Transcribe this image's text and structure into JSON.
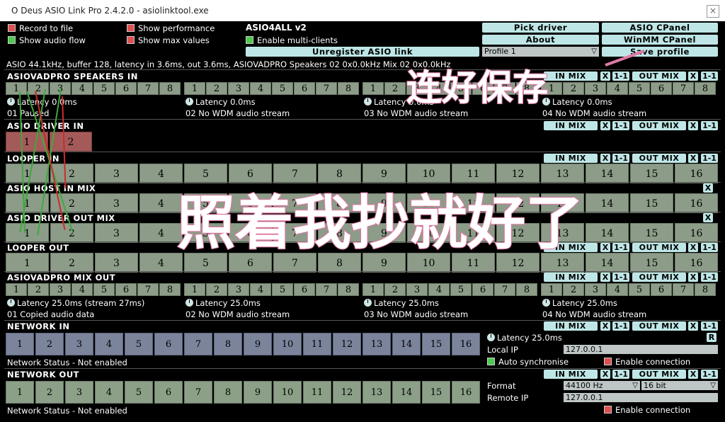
{
  "window": {
    "title": "O Deus ASIO Link Pro 2.4.2.0 - asiolinktool.exe",
    "close": "×"
  },
  "options": {
    "record_to_file": "Record to file",
    "show_audio_flow": "Show audio flow",
    "show_performance": "Show performance",
    "show_max_values": "Show max values",
    "enable_multi_clients": "Enable multi-clients"
  },
  "driver": {
    "name": "ASIO4ALL v2"
  },
  "buttons": {
    "pick_driver": "Pick driver",
    "asio_cpanel": "ASIO CPanel",
    "about": "About",
    "winmm_cpanel": "WinMM CPanel",
    "unregister": "Unregister ASIO link",
    "save_profile": "Save profile"
  },
  "profile": {
    "selected": "Profile 1"
  },
  "status_line": "ASIO 44.1kHz, buffer 128, latency in 3.6ms, out 3.6ms, ASIOVADPRO Speakers 02 0x0.0kHz Mix 02 0x0.0kHz",
  "controls": {
    "in_mix": "IN MIX",
    "out_mix": "OUT MIX",
    "x": "X",
    "one_to_one": "1-1",
    "r": "R"
  },
  "sections": {
    "speakers_in": {
      "title": "ASIOVADPRO SPEAKERS IN",
      "groups": [
        {
          "channels": [
            "1",
            "2",
            "3",
            "4",
            "5",
            "6",
            "7",
            "8"
          ],
          "latency": "Latency 0.0ms",
          "status": "01 Paused"
        },
        {
          "channels": [
            "1",
            "2",
            "3",
            "4",
            "5",
            "6",
            "7",
            "8"
          ],
          "latency": "Latency 0.0ms",
          "status": "02 No WDM audio stream"
        },
        {
          "channels": [
            "1",
            "2",
            "3",
            "4",
            "5",
            "6",
            "7",
            "8"
          ],
          "latency": "Latency 0.0ms",
          "status": "03 No WDM audio stream"
        },
        {
          "channels": [
            "1",
            "2",
            "3",
            "4",
            "5",
            "6",
            "7",
            "8"
          ],
          "latency": "Latency 0.0ms",
          "status": "04 No WDM audio stream"
        }
      ]
    },
    "driver_in": {
      "title": "ASIO DRIVER IN",
      "channels": [
        "1",
        "2"
      ]
    },
    "looper_in": {
      "title": "LOOPER IN",
      "channels": [
        "1",
        "2",
        "3",
        "4",
        "5",
        "6",
        "7",
        "8",
        "9",
        "10",
        "11",
        "12",
        "13",
        "14",
        "15",
        "16"
      ]
    },
    "host_in_mix": {
      "title": "ASIO HOST IN MIX",
      "channels": [
        "1",
        "2",
        "3",
        "4",
        "5",
        "6",
        "7",
        "8",
        "9",
        "10",
        "11",
        "12",
        "13",
        "14",
        "15",
        "16"
      ]
    },
    "driver_out_mix": {
      "title": "ASIO DRIVER OUT MIX",
      "channels": [
        "1",
        "2",
        "3",
        "4",
        "5",
        "6",
        "7",
        "8",
        "9",
        "10",
        "11",
        "12",
        "13",
        "14",
        "15",
        "16"
      ]
    },
    "looper_out": {
      "title": "LOOPER OUT",
      "channels": [
        "1",
        "2",
        "3",
        "4",
        "5",
        "6",
        "7",
        "8",
        "9",
        "10",
        "11",
        "12",
        "13",
        "14",
        "15",
        "16"
      ]
    },
    "mix_out": {
      "title": "ASIOVADPRO MIX OUT",
      "groups": [
        {
          "channels": [
            "1",
            "2",
            "3",
            "4",
            "5",
            "6",
            "7",
            "8"
          ],
          "latency": "Latency 25.0ms (stream 27ms)",
          "status": "01 Copied audio data"
        },
        {
          "channels": [
            "1",
            "2",
            "3",
            "4",
            "5",
            "6",
            "7",
            "8"
          ],
          "latency": "Latency 25.0ms",
          "status": "02 No WDM audio stream"
        },
        {
          "channels": [
            "1",
            "2",
            "3",
            "4",
            "5",
            "6",
            "7",
            "8"
          ],
          "latency": "Latency 25.0ms",
          "status": "03 No WDM audio stream"
        },
        {
          "channels": [
            "1",
            "2",
            "3",
            "4",
            "5",
            "6",
            "7",
            "8"
          ],
          "latency": "Latency 25.0ms",
          "status": "04 No WDM audio stream"
        }
      ]
    },
    "network_in": {
      "title": "NETWORK IN",
      "channels": [
        "1",
        "2",
        "3",
        "4",
        "5",
        "6",
        "7",
        "8",
        "9",
        "10",
        "11",
        "12",
        "13",
        "14",
        "15",
        "16"
      ],
      "status": "Network Status - Not enabled",
      "latency": "Latency 25.0ms",
      "local_ip_label": "Local IP",
      "local_ip": "127.0.0.1",
      "auto_sync": "Auto synchronise",
      "enable_connection": "Enable connection"
    },
    "network_out": {
      "title": "NETWORK OUT",
      "channels": [
        "1",
        "2",
        "3",
        "4",
        "5",
        "6",
        "7",
        "8",
        "9",
        "10",
        "11",
        "12",
        "13",
        "14",
        "15",
        "16"
      ],
      "status": "Network Status - Not enabled",
      "format_label": "Format",
      "format_rate": "44100 Hz",
      "format_bits": "16 bit",
      "remote_ip_label": "Remote IP",
      "remote_ip": "127.0.0.1",
      "enable_connection": "Enable connection"
    }
  },
  "annotations": {
    "top": "连好保存",
    "middle": "照着我抄就好了"
  },
  "colors": {
    "accent_button": "#bfe6e6",
    "channel": "#8c9c88",
    "network_in_channel": "#7c849c",
    "annotation_stroke": "#e07aa5"
  }
}
